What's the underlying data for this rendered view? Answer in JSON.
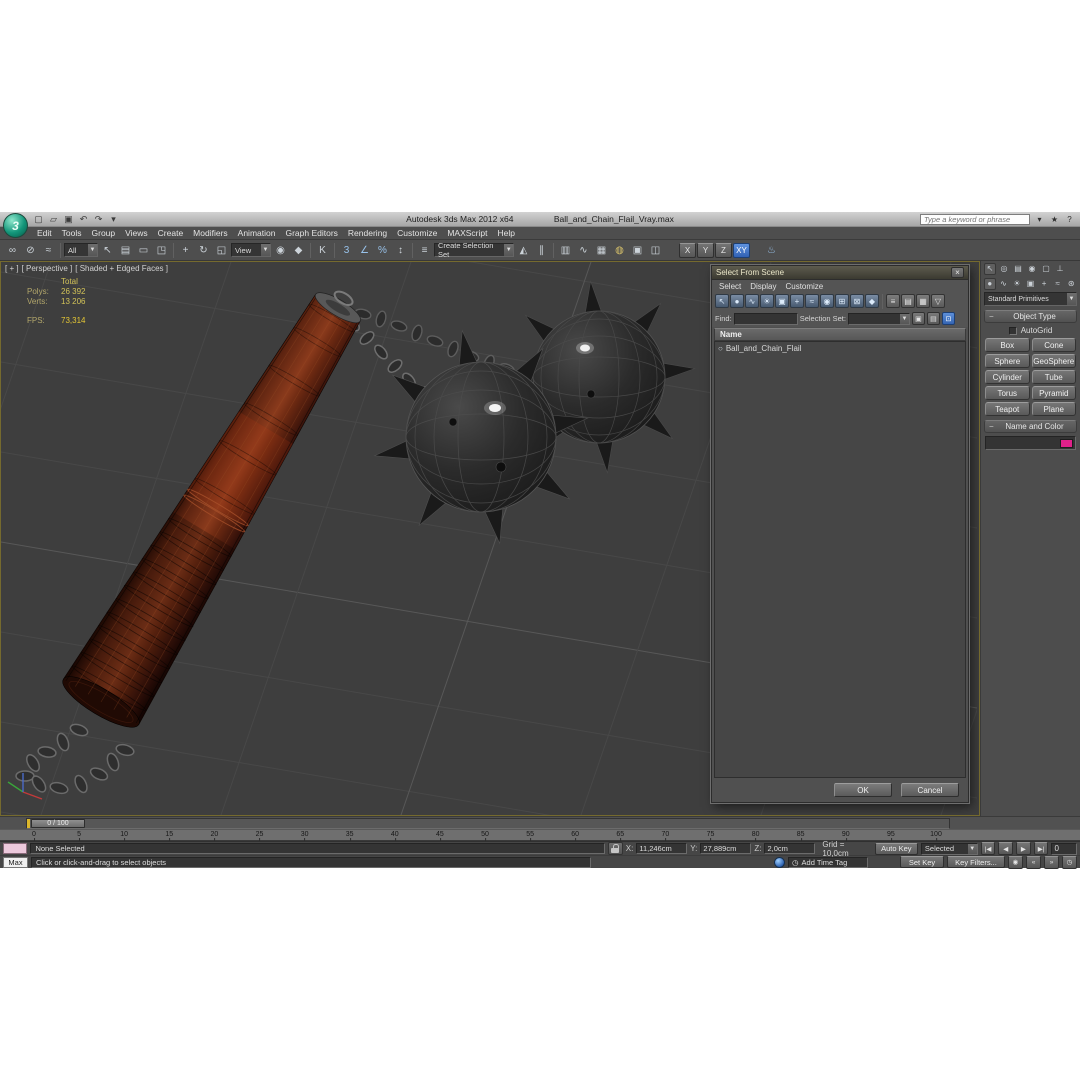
{
  "window": {
    "app_title": "Autodesk 3ds Max  2012 x64",
    "doc_title": "Ball_and_Chain_Flail_Vray.max",
    "search_placeholder": "Type a keyword or phrase"
  },
  "menus": [
    "Edit",
    "Tools",
    "Group",
    "Views",
    "Create",
    "Modifiers",
    "Animation",
    "Graph Editors",
    "Rendering",
    "Customize",
    "MAXScript",
    "Help"
  ],
  "toolbar": {
    "filter": "All",
    "coord_system": "View",
    "selection_set": "Create Selection Set",
    "axis_x": "X",
    "axis_y": "Y",
    "axis_z": "Z",
    "axis_xy": "XY"
  },
  "viewport": {
    "label_plus": "[ + ]",
    "label_view": "[ Perspective ]",
    "label_shading": "[ Shaded + Edged Faces ]",
    "stats": {
      "total": "Total",
      "polys_label": "Polys:",
      "polys": "26 392",
      "verts_label": "Verts:",
      "verts": "13 206",
      "fps_label": "FPS:",
      "fps": "73,314"
    }
  },
  "dialog": {
    "title": "Select From Scene",
    "menus": [
      "Select",
      "Display",
      "Customize"
    ],
    "find_label": "Find:",
    "selection_set_label": "Selection Set:",
    "name_column": "Name",
    "rows": [
      "Ball_and_Chain_Flail"
    ],
    "ok": "OK",
    "cancel": "Cancel"
  },
  "command_panel": {
    "dropdown": "Standard Primitives",
    "object_type": "Object Type",
    "autogrid": "AutoGrid",
    "buttons": [
      "Box",
      "Cone",
      "Sphere",
      "GeoSphere",
      "Cylinder",
      "Tube",
      "Torus",
      "Pyramid",
      "Teapot",
      "Plane"
    ],
    "name_and_color": "Name and Color"
  },
  "timeline": {
    "slider": "0 / 100",
    "ticks": [
      "0",
      "5",
      "10",
      "15",
      "20",
      "25",
      "30",
      "35",
      "40",
      "45",
      "50",
      "55",
      "60",
      "65",
      "70",
      "75",
      "80",
      "85",
      "90",
      "95",
      "100"
    ]
  },
  "status": {
    "selection": "None Selected",
    "x_label": "X:",
    "x": "11,246cm",
    "y_label": "Y:",
    "y": "27,889cm",
    "z_label": "Z:",
    "z": "2,0cm",
    "grid": "Grid = 10,0cm",
    "auto_key": "Auto Key",
    "set_key": "Set Key",
    "selected": "Selected",
    "key_filters": "Key Filters...",
    "frame": "0",
    "max_listener": "Max",
    "prompt": "Click or click-and-drag to select objects",
    "add_time_tag": "Add Time Tag"
  },
  "colors": {
    "object_color": "#e0218a",
    "active_axis_constraint": "#3d7edb",
    "viewport_bg": "#3e3e3e"
  },
  "icons": {
    "app_logo": "3",
    "qat": [
      "▢",
      "▱",
      "▣",
      "↶",
      "↷",
      "▾"
    ],
    "info": [
      "▾",
      "★",
      "?"
    ],
    "dropdown_arrow": "▼",
    "tb": {
      "link": "∞",
      "unlink": "⊘",
      "bindsw": "≈",
      "select": "↖",
      "selname": "▤",
      "region": "▭",
      "wincross": "◳",
      "move": "+",
      "rotate": "↻",
      "scale": "◱",
      "center": "◉",
      "manip": "◆",
      "kbd": "K",
      "snap": "3",
      "angle": "∠",
      "percent": "%",
      "spinner": "↕",
      "sets": "≡",
      "mirror": "◭",
      "align": "∥",
      "layers": "▥",
      "curve": "∿",
      "schem": "▦",
      "mtl": "◍",
      "rsetup": "▣",
      "rfw": "◫",
      "render": "♨"
    },
    "dlg": {
      "toggles": [
        "↖",
        "●",
        "∿",
        "☀",
        "▣",
        "+",
        "≈",
        "◉",
        "⊞",
        "⊠",
        "◆"
      ],
      "views": [
        "≡",
        "▤",
        "▦",
        "▽"
      ],
      "find": [
        "▣",
        "▤",
        "⊡"
      ],
      "row": "○",
      "close": "×"
    },
    "cp_tabs": [
      "↖",
      "◎",
      "▤",
      "◉",
      "▢",
      "⊥"
    ],
    "cp_cats": [
      "●",
      "∿",
      "☀",
      "▣",
      "+",
      "≈",
      "⊛"
    ],
    "play1": [
      "|◀",
      "◀",
      "▶",
      "▶|"
    ],
    "play2": [
      "◉",
      "«",
      "»",
      "◷"
    ],
    "time_tag_clock": "◷"
  }
}
